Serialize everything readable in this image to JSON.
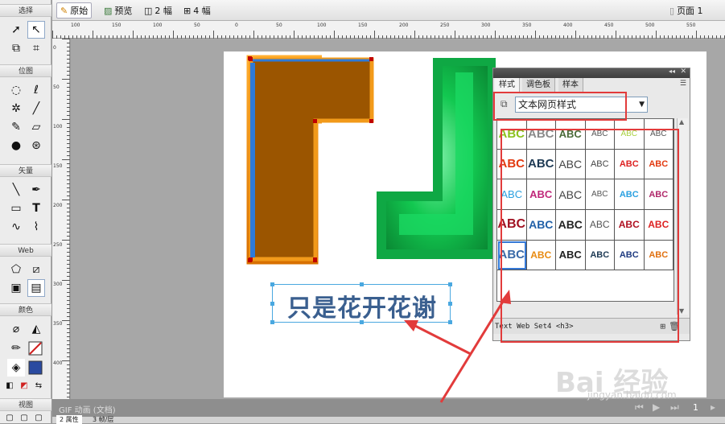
{
  "toolbox": {
    "select": "选择",
    "bitmap": "位图",
    "vector": "矢量",
    "web": "Web",
    "colors": "颜色",
    "view": "视图"
  },
  "doc_toolbar": {
    "original": "原始",
    "preview": "预览",
    "two_up": "2 幅",
    "four_up": "4 幅",
    "page": "页面 1"
  },
  "rulers": {
    "h": [
      "100",
      "150",
      "100",
      "50",
      "0",
      "50",
      "100",
      "150",
      "200",
      "250",
      "300",
      "350",
      "400",
      "450",
      "500",
      "550",
      "600"
    ],
    "v": [
      "0",
      "50",
      "100",
      "150",
      "200",
      "250",
      "300",
      "350",
      "400"
    ]
  },
  "canvas": {
    "text_object": "只是花开花谢"
  },
  "status": {
    "left": "GIF 动画 (文档)",
    "frame": "1"
  },
  "bottom_tabs": [
    "2 属性",
    "3 帧/层"
  ],
  "panel": {
    "tabs": [
      "样式",
      "调色板",
      "样本"
    ],
    "dropdown": "文本网页样式",
    "footer": "Text Web Set4 <h3>",
    "cells": [
      {
        "t": "ABC",
        "c": "#8bc21d",
        "s": 15,
        "w": "bold"
      },
      {
        "t": "ABC",
        "c": "#8a8a8a",
        "s": 15,
        "w": "bold"
      },
      {
        "t": "ABC",
        "c": "#4a6a38",
        "s": 13,
        "w": "bold"
      },
      {
        "t": "ABC",
        "c": "#555",
        "s": 10,
        "w": "normal"
      },
      {
        "t": "ABC",
        "c": "#a8d040",
        "s": 10,
        "w": "normal"
      },
      {
        "t": "ABC",
        "c": "#555",
        "s": 10,
        "w": "normal"
      },
      {
        "t": "ABC",
        "c": "#e23a10",
        "s": 15,
        "w": "bold"
      },
      {
        "t": "ABC",
        "c": "#1e3a54",
        "s": 15,
        "w": "bold"
      },
      {
        "t": "ABC",
        "c": "#444",
        "s": 14,
        "w": "normal"
      },
      {
        "t": "ABC",
        "c": "#444",
        "s": 11,
        "w": "normal"
      },
      {
        "t": "ABC",
        "c": "#d22",
        "s": 11,
        "w": "bold"
      },
      {
        "t": "ABC",
        "c": "#e23a10",
        "s": 11,
        "w": "bold"
      },
      {
        "t": "ABC",
        "c": "#2aa0e0",
        "s": 13,
        "w": "normal"
      },
      {
        "t": "ABC",
        "c": "#c0287a",
        "s": 13,
        "w": "bold"
      },
      {
        "t": "ABC",
        "c": "#444",
        "s": 14,
        "w": "normal"
      },
      {
        "t": "ABC",
        "c": "#555",
        "s": 10,
        "w": "normal"
      },
      {
        "t": "ABC",
        "c": "#2aa0e0",
        "s": 11,
        "w": "bold"
      },
      {
        "t": "ABC",
        "c": "#b0286a",
        "s": 11,
        "w": "bold"
      },
      {
        "t": "ABC",
        "c": "#a01020",
        "s": 16,
        "w": "bold"
      },
      {
        "t": "ABC",
        "c": "#2060a8",
        "s": 14,
        "w": "bold"
      },
      {
        "t": "ABC",
        "c": "#222",
        "s": 14,
        "w": "bold"
      },
      {
        "t": "ABC",
        "c": "#555",
        "s": 12,
        "w": "normal"
      },
      {
        "t": "ABC",
        "c": "#b01020",
        "s": 12,
        "w": "bold"
      },
      {
        "t": "ABC",
        "c": "#d22",
        "s": 12,
        "w": "bold"
      },
      {
        "t": "ABC",
        "c": "#3a6aa8",
        "s": 15,
        "w": "bold"
      },
      {
        "t": "ABC",
        "c": "#e88a10",
        "s": 12,
        "w": "bold"
      },
      {
        "t": "ABC",
        "c": "#222",
        "s": 13,
        "w": "bold"
      },
      {
        "t": "ABC",
        "c": "#1e3a54",
        "s": 11,
        "w": "bold"
      },
      {
        "t": "ABC",
        "c": "#1e3a80",
        "s": 11,
        "w": "bold"
      },
      {
        "t": "ABC",
        "c": "#e07010",
        "s": 11,
        "w": "bold"
      }
    ]
  },
  "colors": {
    "accent_red": "#e23b3b",
    "brown_shape": "#9b5500",
    "green_shape": "#11c24f",
    "text_blue": "#3a5f8f",
    "stroke_swatch": "#d02020",
    "fill_swatch": "#2a4aa0"
  },
  "watermark": {
    "brand": "Bai 经验",
    "url": "jingyan.baidu.com"
  }
}
